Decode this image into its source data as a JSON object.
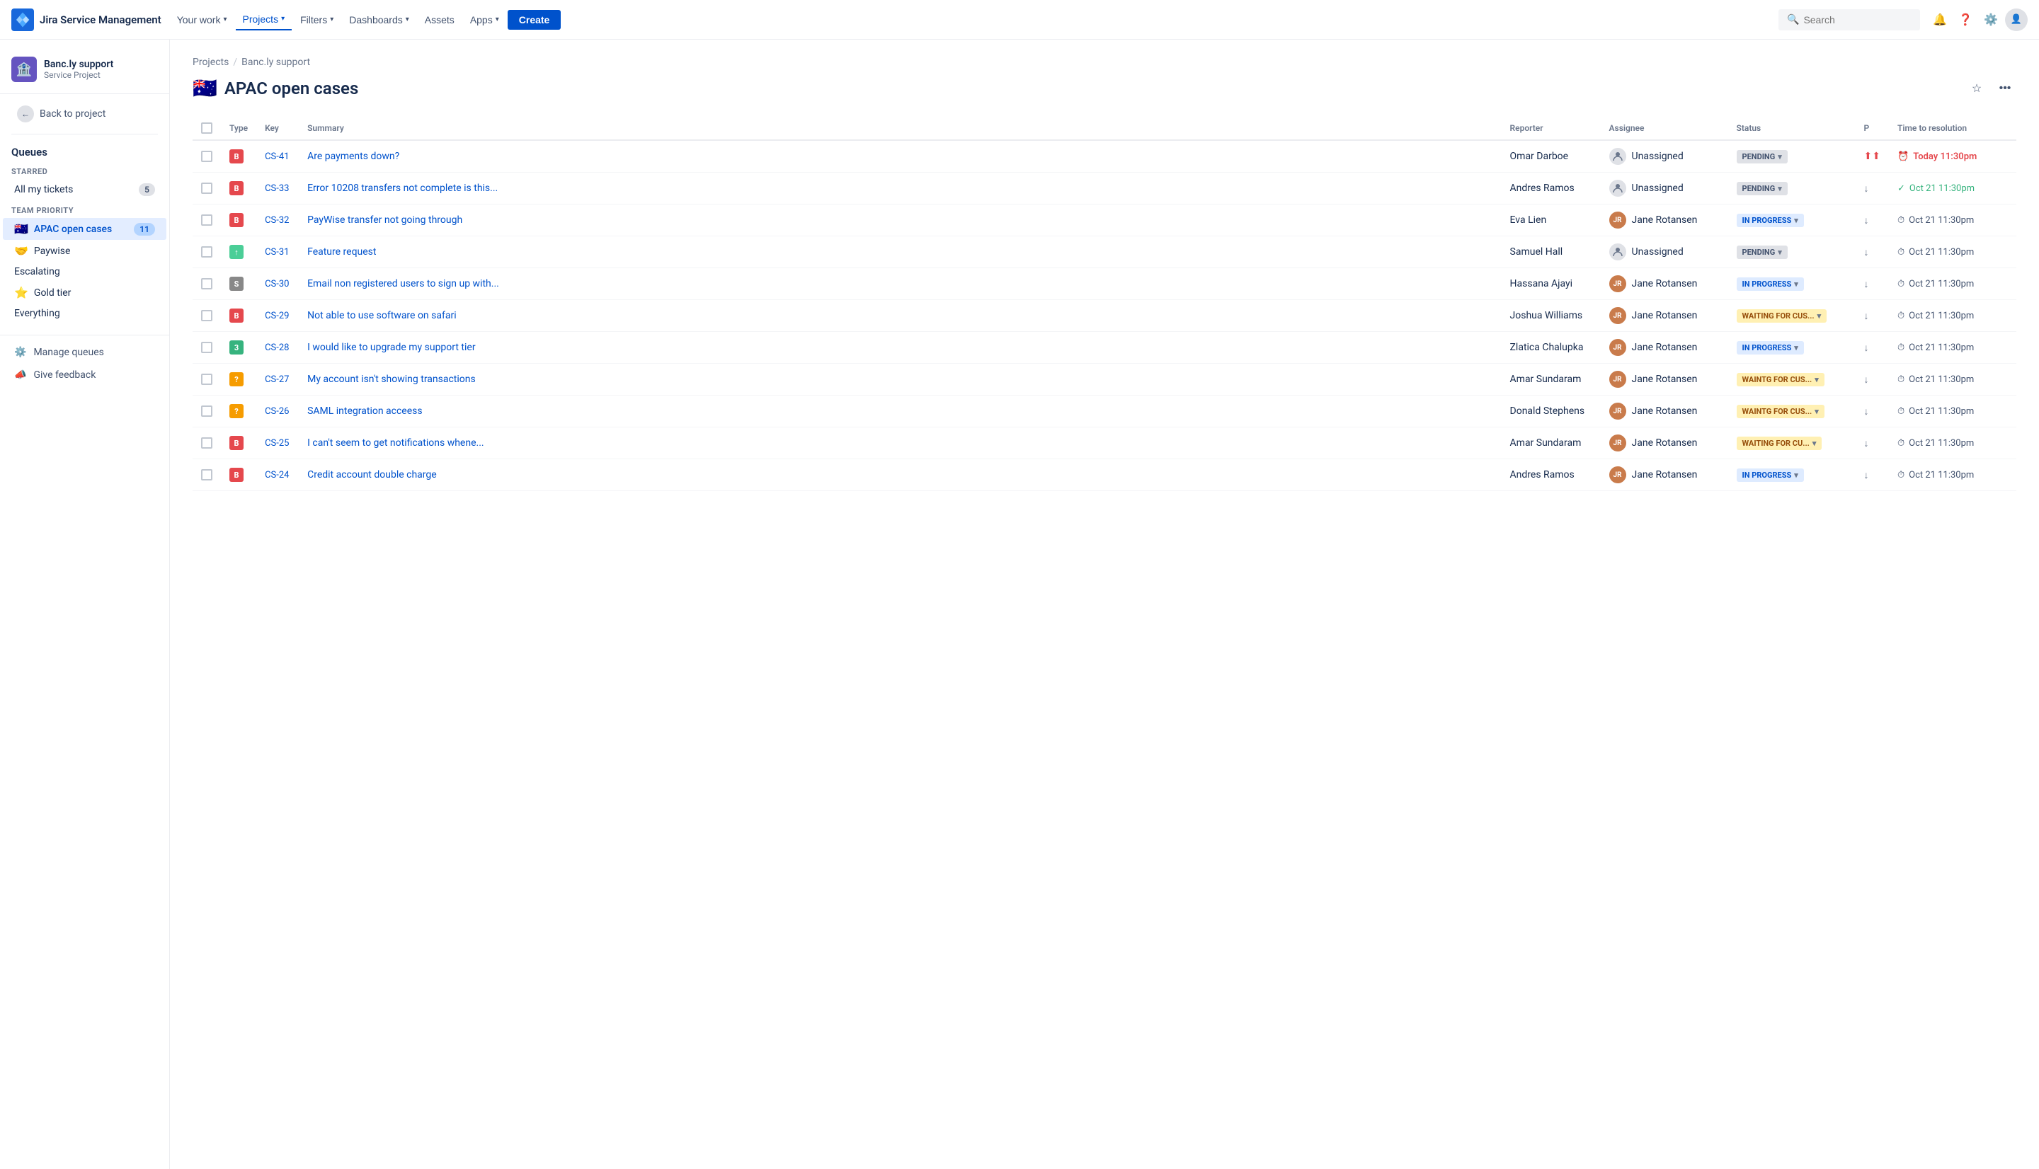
{
  "app": {
    "name": "Jira Service Management"
  },
  "topnav": {
    "logo_text": "Jira Service Management",
    "nav_items": [
      {
        "label": "Your work",
        "has_chevron": true,
        "active": false
      },
      {
        "label": "Projects",
        "has_chevron": true,
        "active": true
      },
      {
        "label": "Filters",
        "has_chevron": true,
        "active": false
      },
      {
        "label": "Dashboards",
        "has_chevron": true,
        "active": false
      },
      {
        "label": "Assets",
        "has_chevron": false,
        "active": false
      },
      {
        "label": "Apps",
        "has_chevron": true,
        "active": false
      }
    ],
    "create_label": "Create",
    "search_placeholder": "Search"
  },
  "sidebar": {
    "project_name": "Banc.ly support",
    "project_type": "Service Project",
    "back_label": "Back to project",
    "queues_label": "Queues",
    "starred_label": "STARRED",
    "starred_items": [
      {
        "label": "All my tickets",
        "badge": "5",
        "active": false
      }
    ],
    "team_priority_label": "TEAM PRIORITY",
    "team_items": [
      {
        "label": "APAC open cases",
        "emoji": "🇦🇺",
        "badge": "11",
        "active": true
      },
      {
        "label": "Paywise",
        "emoji": "🤝",
        "badge": "",
        "active": false
      },
      {
        "label": "Escalating",
        "emoji": "",
        "badge": "",
        "active": false
      },
      {
        "label": "Gold tier",
        "emoji": "⭐",
        "badge": "",
        "active": false
      },
      {
        "label": "Everything",
        "emoji": "",
        "badge": "",
        "active": false
      }
    ],
    "manage_queues_label": "Manage queues",
    "give_feedback_label": "Give feedback"
  },
  "breadcrumb": {
    "items": [
      "Projects",
      "Banc.ly support"
    ]
  },
  "page": {
    "title": "APAC open cases",
    "emoji": "🇦🇺"
  },
  "table": {
    "columns": [
      "Type",
      "Key",
      "Summary",
      "Reporter",
      "Assignee",
      "Status",
      "P",
      "Time to resolution"
    ],
    "rows": [
      {
        "type": "bug",
        "type_label": "B",
        "key": "CS-41",
        "summary": "Are payments down?",
        "reporter": "Omar Darboe",
        "assignee": "Unassigned",
        "assignee_avatar": "unassigned",
        "status": "PENDING",
        "status_type": "pending",
        "priority": "high",
        "time": "Today 11:30pm",
        "time_type": "overdue",
        "time_icon": "⏰"
      },
      {
        "type": "bug",
        "type_label": "B",
        "key": "CS-33",
        "summary": "Error 10208 transfers not complete is this...",
        "reporter": "Andres Ramos",
        "assignee": "Unassigned",
        "assignee_avatar": "unassigned",
        "status": "PENDING",
        "status_type": "pending",
        "priority": "medium",
        "time": "Oct 21 11:30pm",
        "time_type": "ok",
        "time_icon": "✓"
      },
      {
        "type": "bug",
        "type_label": "B",
        "key": "CS-32",
        "summary": "PayWise transfer not going through",
        "reporter": "Eva Lien",
        "assignee": "Jane Rotansen",
        "assignee_avatar": "jr",
        "status": "IN PROGRESS",
        "status_type": "inprogress",
        "priority": "medium",
        "time": "Oct 21 11:30pm",
        "time_type": "due",
        "time_icon": "⏱"
      },
      {
        "type": "task",
        "type_label": "↑",
        "key": "CS-31",
        "summary": "Feature request",
        "reporter": "Samuel Hall",
        "assignee": "Unassigned",
        "assignee_avatar": "unassigned",
        "status": "PENDING",
        "status_type": "pending",
        "priority": "medium",
        "time": "Oct 21 11:30pm",
        "time_type": "due",
        "time_icon": "⏱"
      },
      {
        "type": "service",
        "type_label": "S",
        "key": "CS-30",
        "summary": "Email non registered users to sign up with...",
        "reporter": "Hassana Ajayi",
        "assignee": "Jane Rotansen",
        "assignee_avatar": "jr",
        "status": "IN PROGRESS",
        "status_type": "inprogress",
        "priority": "medium",
        "time": "Oct 21 11:30pm",
        "time_type": "due",
        "time_icon": "⏱"
      },
      {
        "type": "bug",
        "type_label": "B",
        "key": "CS-29",
        "summary": "Not able to use software on safari",
        "reporter": "Joshua Williams",
        "assignee": "Jane Rotansen",
        "assignee_avatar": "jr",
        "status": "WAITING FOR CUS...",
        "status_type": "waiting",
        "priority": "medium",
        "time": "Oct 21 11:30pm",
        "time_type": "due",
        "time_icon": "⏱"
      },
      {
        "type": "story",
        "type_label": "3",
        "key": "CS-28",
        "summary": "I would like to upgrade my support tier",
        "reporter": "Zlatica Chalupka",
        "assignee": "Jane Rotansen",
        "assignee_avatar": "jr",
        "status": "IN PROGRESS",
        "status_type": "inprogress",
        "priority": "medium",
        "time": "Oct 21 11:30pm",
        "time_type": "due",
        "time_icon": "⏱"
      },
      {
        "type": "question",
        "type_label": "?",
        "key": "CS-27",
        "summary": "My account isn't showing transactions",
        "reporter": "Amar Sundaram",
        "assignee": "Jane Rotansen",
        "assignee_avatar": "jr",
        "status": "WAINTG FOR CUS...",
        "status_type": "waiting",
        "priority": "medium",
        "time": "Oct 21 11:30pm",
        "time_type": "due",
        "time_icon": "⏱"
      },
      {
        "type": "question",
        "type_label": "?",
        "key": "CS-26",
        "summary": "SAML integration acceess",
        "reporter": "Donald Stephens",
        "assignee": "Jane Rotansen",
        "assignee_avatar": "jr",
        "status": "WAINTG FOR CUS...",
        "status_type": "waiting",
        "priority": "medium",
        "time": "Oct 21 11:30pm",
        "time_type": "due",
        "time_icon": "⏱"
      },
      {
        "type": "bug",
        "type_label": "B",
        "key": "CS-25",
        "summary": "I can't seem to get notifications whene...",
        "reporter": "Amar Sundaram",
        "assignee": "Jane Rotansen",
        "assignee_avatar": "jr",
        "status": "WAITING FOR CU...",
        "status_type": "waiting",
        "priority": "medium",
        "time": "Oct 21 11:30pm",
        "time_type": "due",
        "time_icon": "⏱"
      },
      {
        "type": "bug",
        "type_label": "B",
        "key": "CS-24",
        "summary": "Credit account double charge",
        "reporter": "Andres Ramos",
        "assignee": "Jane Rotansen",
        "assignee_avatar": "jr",
        "status": "IN PROGRESS",
        "status_type": "inprogress",
        "priority": "medium",
        "time": "Oct 21 11:30pm",
        "time_type": "due",
        "time_icon": "⏱"
      }
    ]
  },
  "colors": {
    "accent": "#0052cc",
    "bug": "#e5484d",
    "task": "#4bce97",
    "question": "#f69c00",
    "service": "#888",
    "story": "#36b37e"
  }
}
